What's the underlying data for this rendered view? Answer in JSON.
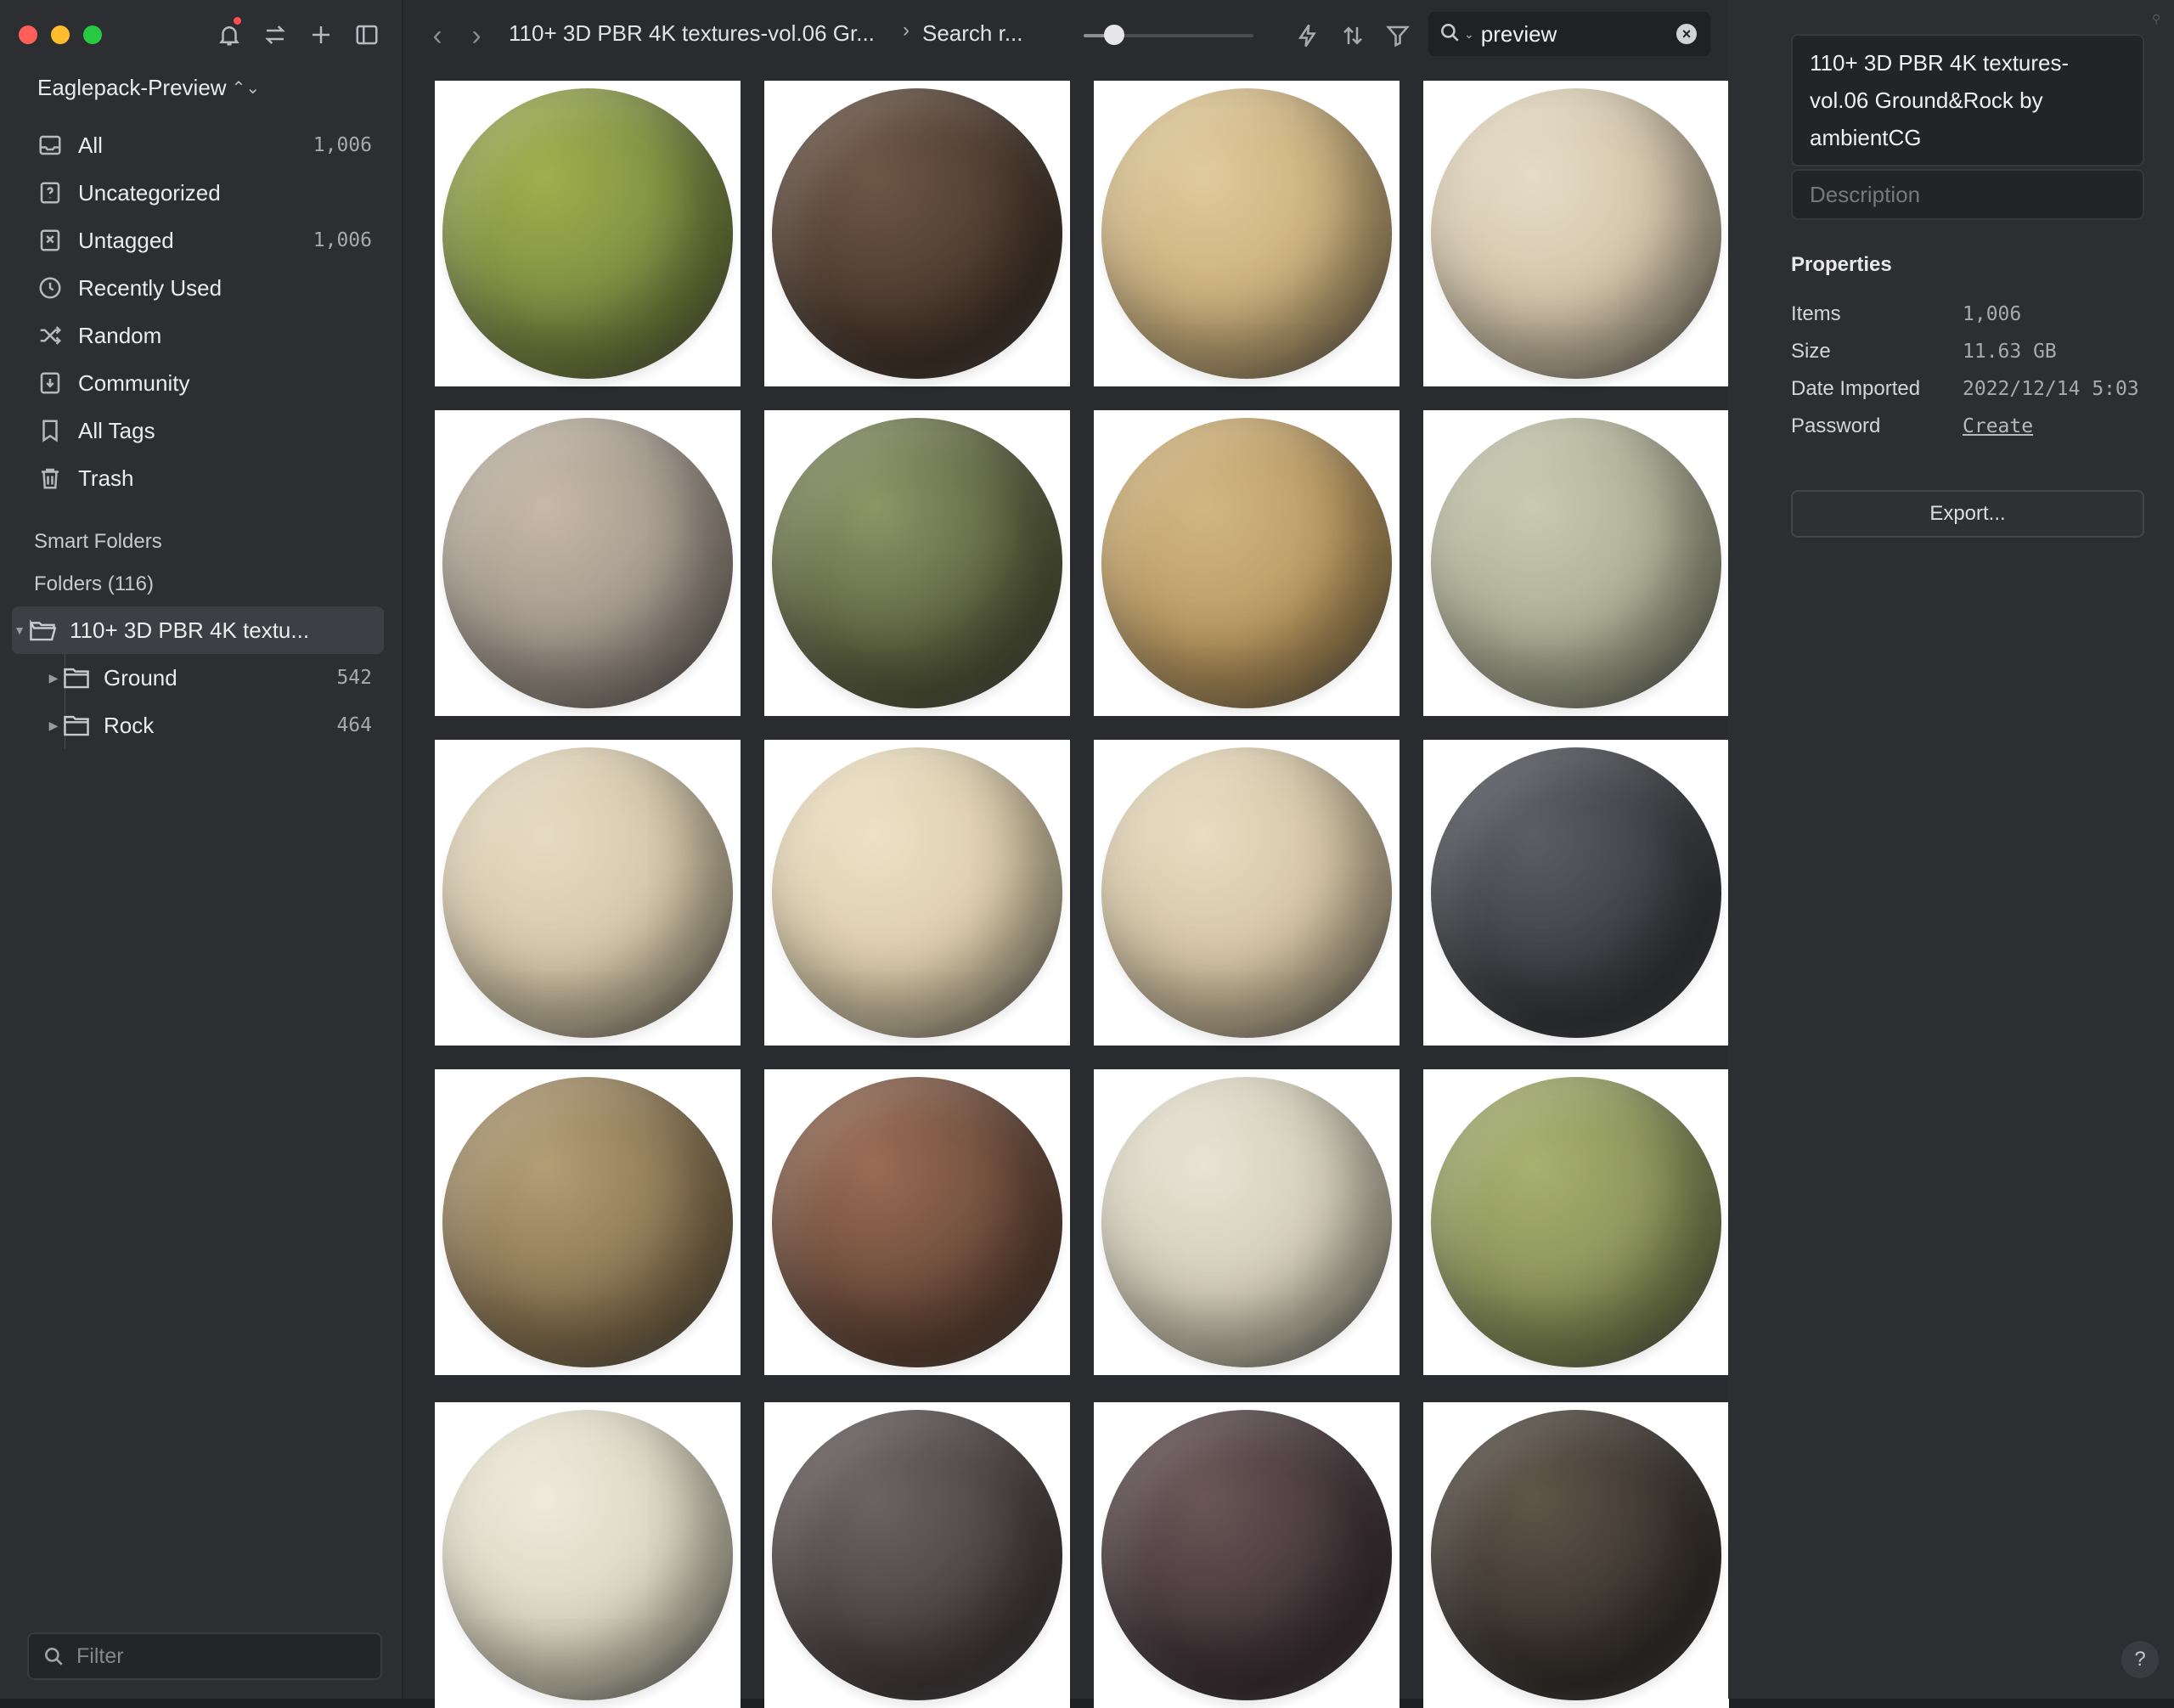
{
  "sidebar": {
    "library_name": "Eaglepack-Preview",
    "nav_items": [
      {
        "label": "All",
        "count": "1,006",
        "icon": "inbox-icon"
      },
      {
        "label": "Uncategorized",
        "count": "",
        "icon": "question-box-icon"
      },
      {
        "label": "Untagged",
        "count": "1,006",
        "icon": "untagged-icon"
      },
      {
        "label": "Recently Used",
        "count": "",
        "icon": "clock-icon"
      },
      {
        "label": "Random",
        "count": "",
        "icon": "shuffle-icon"
      },
      {
        "label": "Community",
        "count": "",
        "icon": "download-box-icon"
      },
      {
        "label": "All Tags",
        "count": "",
        "icon": "bookmark-icon"
      },
      {
        "label": "Trash",
        "count": "",
        "icon": "trash-icon"
      }
    ],
    "smart_folders_label": "Smart Folders",
    "folders_label": "Folders (116)",
    "folders": [
      {
        "label": "110+ 3D PBR 4K textu...",
        "count": "",
        "selected": true
      },
      {
        "label": "Ground",
        "count": "542",
        "selected": false
      },
      {
        "label": "Rock",
        "count": "464",
        "selected": false
      }
    ],
    "filter_placeholder": "Filter"
  },
  "toolbar": {
    "breadcrumb_folder": "110+ 3D PBR 4K textures-vol.06 Gr...",
    "breadcrumb_search": "Search r...",
    "zoom_level": 0.18,
    "search_value": "preview"
  },
  "grid": {
    "spheres": [
      {
        "color": "#7c8a42",
        "accent": "#a0b04c"
      },
      {
        "color": "#4b3a2e",
        "accent": "#6d5646"
      },
      {
        "color": "#c7ac79",
        "accent": "#e0cb9c"
      },
      {
        "color": "#cfc1a6",
        "accent": "#e6dcc6"
      },
      {
        "color": "#a1968a",
        "accent": "#c6b9a7"
      },
      {
        "color": "#5d6340",
        "accent": "#8c9767"
      },
      {
        "color": "#b7975f",
        "accent": "#d2b783"
      },
      {
        "color": "#a9ab91",
        "accent": "#c9cab0"
      },
      {
        "color": "#d2c4a6",
        "accent": "#e6dbc3"
      },
      {
        "color": "#d9caa8",
        "accent": "#ede1c6"
      },
      {
        "color": "#d0c09f",
        "accent": "#e8ddc2"
      },
      {
        "color": "#3b3d42",
        "accent": "#5c5e65"
      },
      {
        "color": "#8a7552",
        "accent": "#b39e76"
      },
      {
        "color": "#6a4a3a",
        "accent": "#9a6c54"
      },
      {
        "color": "#cfc9b3",
        "accent": "#e8e4d4"
      },
      {
        "color": "#889058",
        "accent": "#a7b170"
      },
      {
        "color": "#d7d3bd",
        "accent": "#eeebdc"
      },
      {
        "color": "#4a4142",
        "accent": "#6c6364"
      },
      {
        "color": "#43363a",
        "accent": "#6a5656"
      },
      {
        "color": "#3b3530",
        "accent": "#5f5548"
      }
    ]
  },
  "inspector": {
    "title": "110+ 3D PBR 4K textures-vol.06 Ground&Rock by ambientCG",
    "description_placeholder": "Description",
    "properties_label": "Properties",
    "properties": [
      {
        "key": "Items",
        "value": "1,006"
      },
      {
        "key": "Size",
        "value": "11.63 GB"
      },
      {
        "key": "Date Imported",
        "value": "2022/12/14 5:03"
      },
      {
        "key": "Password",
        "value": "Create"
      }
    ],
    "export_label": "Export...",
    "help_label": "?"
  }
}
